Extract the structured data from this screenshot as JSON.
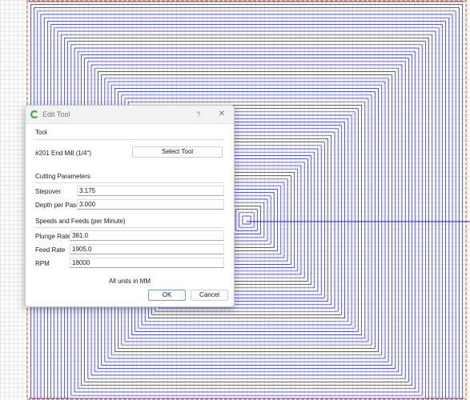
{
  "dialog": {
    "title": "Edit Tool",
    "help_glyph": "?",
    "close_glyph": "✕"
  },
  "tool_section": {
    "title": "Tool",
    "tool_name": "#201 End Mill (1/4\")",
    "select_button": "Select Tool"
  },
  "cutting_section": {
    "title": "Cutting Parameters",
    "fields": [
      {
        "label": "Stepover",
        "value": "3.175"
      },
      {
        "label": "Depth per Pass",
        "value": "3.000"
      }
    ]
  },
  "speeds_section": {
    "title": "Speeds and Feeds (per Minute)",
    "fields": [
      {
        "label": "Plunge Rate",
        "value": "381.0"
      },
      {
        "label": "Feed Rate",
        "value": "1905.0"
      },
      {
        "label": "RPM",
        "value": "18000"
      }
    ]
  },
  "units_note": "All units in MM",
  "buttons": {
    "ok": "OK",
    "cancel": "Cancel"
  },
  "colors": {
    "toolpath": "#2323d2",
    "grid_line": "#d4d4d4",
    "stock_boundary": "#f07030",
    "accent": "#7a9ccd"
  },
  "icons": {
    "app": "app-logo-icon",
    "help": "help-icon",
    "close": "close-icon"
  }
}
